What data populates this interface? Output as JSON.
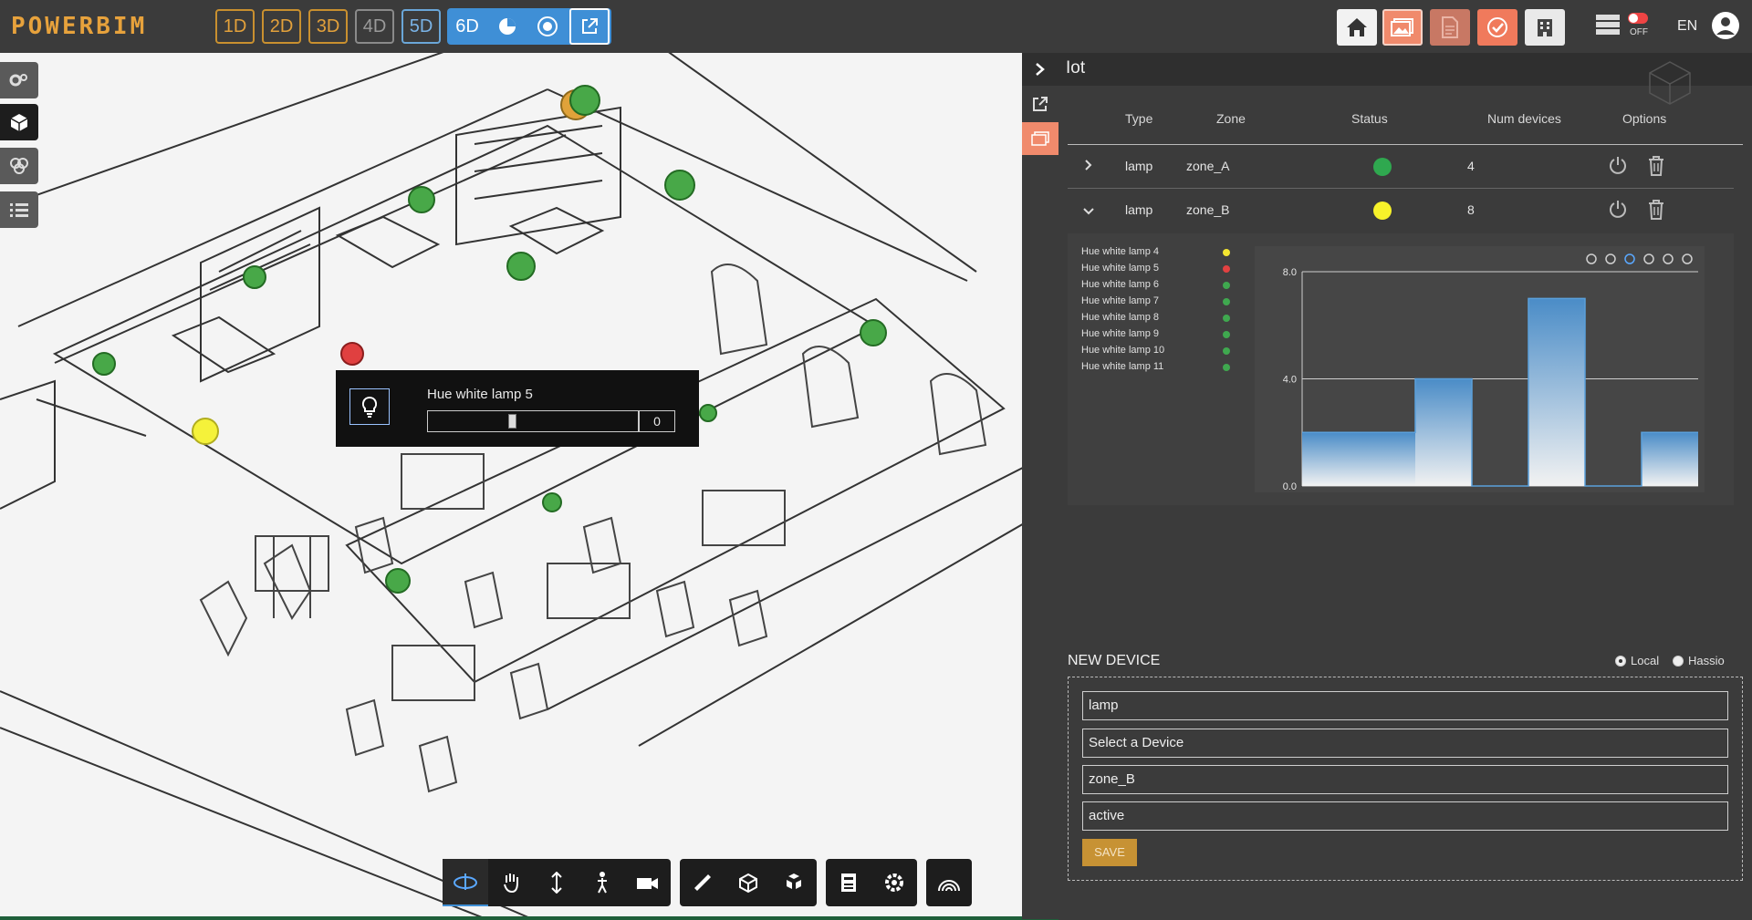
{
  "app": {
    "logo": "POWERBIM",
    "language": "EN"
  },
  "dimensions": [
    {
      "label": "1D",
      "style": "orange"
    },
    {
      "label": "2D",
      "style": "orange"
    },
    {
      "label": "3D",
      "style": "orange"
    },
    {
      "label": "4D",
      "style": "grey"
    },
    {
      "label": "5D",
      "style": "blue"
    }
  ],
  "six_group": {
    "label": "6D",
    "icons": [
      "pie-chart-icon",
      "target-icon",
      "external-link-icon"
    ]
  },
  "top_right": {
    "buttons": [
      "home-icon",
      "gallery-icon",
      "document-icon",
      "clock-check-icon",
      "building-icon"
    ],
    "toggle_label": "OFF"
  },
  "left_tools": [
    "settings-tools-icon",
    "cube-icon",
    "layers-icon",
    "list-icon"
  ],
  "popup": {
    "title": "Hue white lamp 5",
    "value": "0",
    "slider_fraction": 0.4
  },
  "viewport_markers": [
    {
      "color": "green"
    },
    {
      "color": "orange"
    },
    {
      "color": "green"
    },
    {
      "color": "green"
    },
    {
      "color": "green"
    },
    {
      "color": "green"
    },
    {
      "color": "red"
    },
    {
      "color": "green"
    },
    {
      "color": "yellow"
    },
    {
      "color": "green"
    },
    {
      "color": "green"
    },
    {
      "color": "green"
    },
    {
      "color": "green"
    }
  ],
  "bottom_tools": [
    [
      "orbit-icon",
      "hand-pan-icon",
      "vertical-move-icon",
      "walk-person-icon",
      "camera-icon"
    ],
    [
      "ruler-icon",
      "section-box-icon",
      "explode-icon"
    ],
    [
      "properties-icon",
      "gear-icon"
    ],
    [
      "rainbow-icon"
    ]
  ],
  "panel": {
    "title": "Iot",
    "columns": {
      "type": "Type",
      "zone": "Zone",
      "status": "Status",
      "num": "Num devices",
      "options": "Options"
    },
    "rows": [
      {
        "type": "lamp",
        "zone": "zone_A",
        "status_color": "#2fa84f",
        "num": "4"
      },
      {
        "type": "lamp",
        "zone": "zone_B",
        "status_color": "#f7f22a",
        "num": "8"
      }
    ],
    "legend": [
      {
        "name": "Hue white lamp 4",
        "color": "#f3e530"
      },
      {
        "name": "Hue white lamp 5",
        "color": "#e24141"
      },
      {
        "name": "Hue white lamp 6",
        "color": "#3fa84f"
      },
      {
        "name": "Hue white lamp 7",
        "color": "#3fa84f"
      },
      {
        "name": "Hue white lamp 8",
        "color": "#3fa84f"
      },
      {
        "name": "Hue white lamp 9",
        "color": "#3fa84f"
      },
      {
        "name": "Hue white lamp 10",
        "color": "#3fa84f"
      },
      {
        "name": "Hue white lamp 11",
        "color": "#3fa84f"
      }
    ]
  },
  "chart_data": {
    "type": "area",
    "step": true,
    "y_ticks": [
      "8.0",
      "4.0",
      "0.0"
    ],
    "ylim": [
      0,
      8
    ],
    "values": [
      2,
      2,
      4,
      0,
      7,
      0,
      2
    ],
    "grid": true,
    "toolbar": [
      "zoom-in-icon",
      "zoom-out-icon",
      "magnify-icon",
      "pan-hand-icon",
      "reset-home-icon",
      "menu-icon"
    ]
  },
  "new_device": {
    "heading": "NEW DEVICE",
    "radio_local": "Local",
    "radio_hassio": "Hassio",
    "fields": [
      "lamp",
      "Select a Device",
      "zone_B",
      "active"
    ],
    "save": "SAVE"
  }
}
